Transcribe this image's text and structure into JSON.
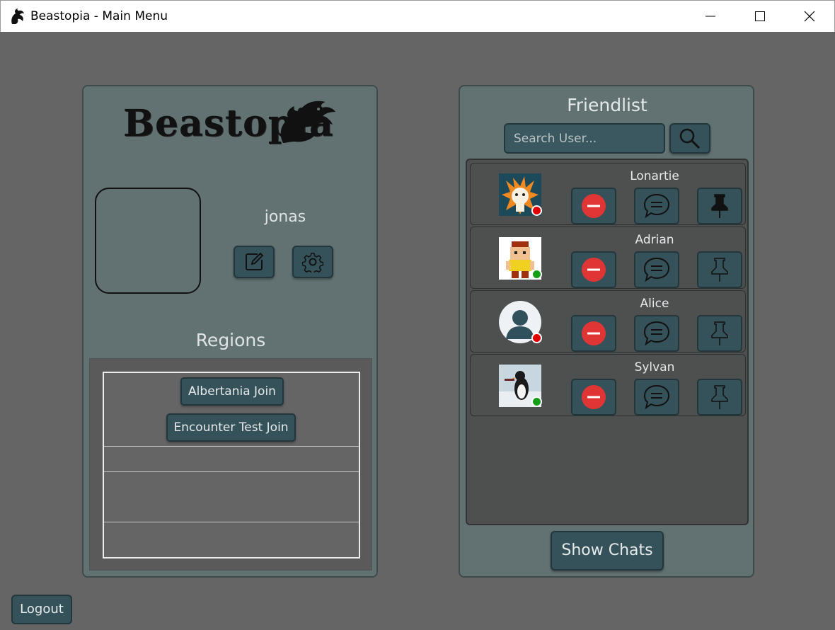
{
  "window": {
    "title": "Beastopia - Main Menu",
    "controls": [
      "minimize-icon",
      "maximize-icon",
      "close-icon"
    ]
  },
  "profile": {
    "logo_text": "Beastopia",
    "username": "jonas",
    "edit_icon": "edit-icon",
    "settings_icon": "gear-icon"
  },
  "regions": {
    "title": "Regions",
    "items": [
      {
        "label": "Albertania Join"
      },
      {
        "label": "Encounter Test Join"
      }
    ]
  },
  "friendlist": {
    "title": "Friendlist",
    "search_placeholder": "Search User...",
    "friends": [
      {
        "name": "Lonartie",
        "status": "offline",
        "status_color": "#e00000",
        "pinned": true
      },
      {
        "name": "Adrian",
        "status": "online",
        "status_color": "#14a014",
        "pinned": false
      },
      {
        "name": "Alice",
        "status": "offline",
        "status_color": "#e00000",
        "pinned": false
      },
      {
        "name": "Sylvan",
        "status": "online",
        "status_color": "#14a014",
        "pinned": false
      }
    ],
    "show_chats_label": "Show Chats"
  },
  "footer": {
    "logout_label": "Logout"
  },
  "colors": {
    "background": "#656565",
    "panel": "#627272",
    "button": "#35525b",
    "remove_red": "#e03535"
  }
}
